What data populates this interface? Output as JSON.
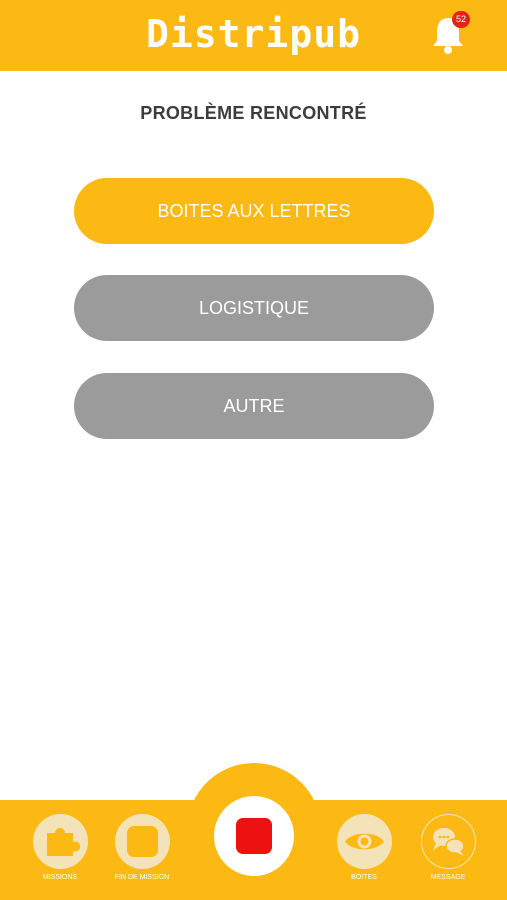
{
  "header": {
    "app_title": "Distripub",
    "notification_count": "52",
    "icon": "bell-icon"
  },
  "page": {
    "title": "PROBLÈME RENCONTRÉ"
  },
  "options": [
    {
      "label": "BOITES AUX LETTRES",
      "state": "selected"
    },
    {
      "label": "LOGISTIQUE",
      "state": "default"
    },
    {
      "label": "AUTRE",
      "state": "default"
    }
  ],
  "bottom_nav": {
    "missions": {
      "label": "MISSIONS",
      "icon": "puzzle-icon"
    },
    "fin_de_mission": {
      "label": "FIN DE MISSION",
      "icon": "rounded-square-icon"
    },
    "record": {
      "icon": "stop-record-icon"
    },
    "boites": {
      "label": "BOITES",
      "icon": "eye-icon"
    },
    "message": {
      "label": "MESSAGE",
      "icon": "chat-bubbles-icon"
    }
  },
  "colors": {
    "accent": "#fdb913",
    "inactive_button": "#9b9b9b",
    "record": "#ee1111",
    "badge": "#e2231a"
  }
}
